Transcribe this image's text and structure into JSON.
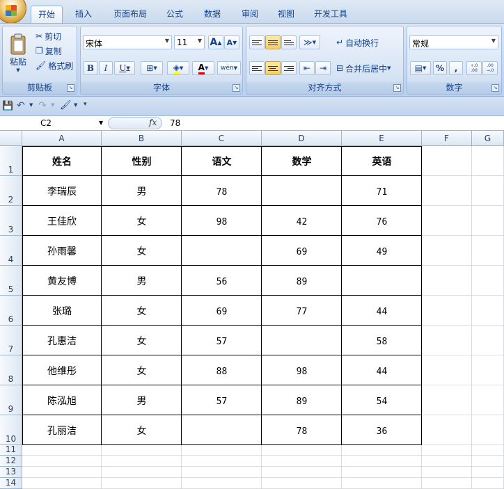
{
  "tabs": [
    "开始",
    "插入",
    "页面布局",
    "公式",
    "数据",
    "审阅",
    "视图",
    "开发工具"
  ],
  "active_tab": "开始",
  "ribbon": {
    "clipboard": {
      "label": "剪贴板",
      "paste": "粘贴",
      "cut": "剪切",
      "copy": "复制",
      "format_painter": "格式刷"
    },
    "font": {
      "label": "字体",
      "font_name": "宋体",
      "font_size": "11",
      "bold": "B",
      "italic": "I",
      "underline": "U",
      "grow": "A",
      "shrink": "A",
      "phonetic": "wén"
    },
    "alignment": {
      "label": "对齐方式",
      "wrap_text": "自动换行",
      "merge_center": "合并后居中"
    },
    "number": {
      "label": "数字",
      "format": "常规",
      "percent": "%",
      "comma": ",",
      "inc_decimal": "+.0 .00",
      "dec_decimal": ".00 →.0"
    }
  },
  "formula_bar": {
    "name_box": "C2",
    "fx": "fx",
    "value": "78"
  },
  "columns": [
    "A",
    "B",
    "C",
    "D",
    "E",
    "F",
    "G"
  ],
  "rows": [
    "1",
    "2",
    "3",
    "4",
    "5",
    "6",
    "7",
    "8",
    "9",
    "10",
    "11",
    "12",
    "13",
    "14"
  ],
  "table": {
    "headers": [
      "姓名",
      "性别",
      "语文",
      "数学",
      "英语"
    ],
    "rows": [
      [
        "李瑞辰",
        "男",
        "78",
        "",
        "71"
      ],
      [
        "王佳欣",
        "女",
        "98",
        "42",
        "76"
      ],
      [
        "孙雨馨",
        "女",
        "",
        "69",
        "49"
      ],
      [
        "黄友博",
        "男",
        "56",
        "89",
        ""
      ],
      [
        "张璐",
        "女",
        "69",
        "77",
        "44"
      ],
      [
        "孔惠洁",
        "女",
        "57",
        "",
        "58"
      ],
      [
        "他维彤",
        "女",
        "88",
        "98",
        "44"
      ],
      [
        "陈泓旭",
        "男",
        "57",
        "89",
        "54"
      ],
      [
        "孔丽洁",
        "女",
        "",
        "78",
        "36"
      ]
    ]
  },
  "colors": {
    "ribbon_bg": "#c4d6ee",
    "accent": "#15428b",
    "active_button": "#f8cd62"
  }
}
